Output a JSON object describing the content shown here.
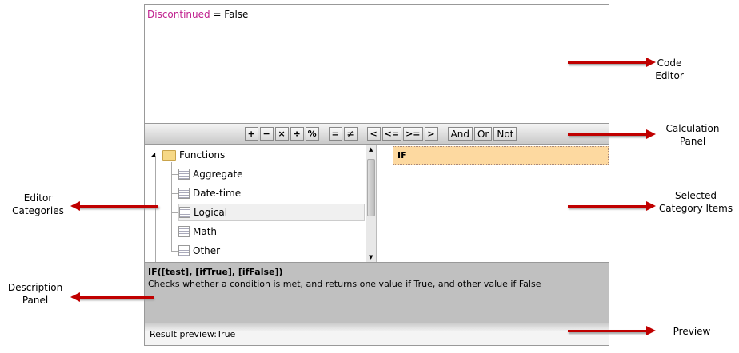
{
  "code": {
    "field": "Discontinued",
    "rest": " = False"
  },
  "toolbar": {
    "ops": [
      "+",
      "−",
      "×",
      "÷",
      "%"
    ],
    "compare": [
      "=",
      "≠"
    ],
    "relational": [
      "<",
      "<=",
      ">=",
      ">"
    ],
    "logic": [
      "And",
      "Or",
      "Not"
    ]
  },
  "tree": {
    "root": "Functions",
    "items": [
      "Aggregate",
      "Date-time",
      "Logical",
      "Math",
      "Other"
    ],
    "selected": "Logical"
  },
  "items": {
    "selected": "IF"
  },
  "description": {
    "signature": "IF([test], [ifTrue], [ifFalse])",
    "text": "Checks whether a condition is met, and returns one value if True, and other value if False"
  },
  "preview": {
    "label": "Result preview:",
    "value": "True"
  },
  "annotations": {
    "code_editor": "Code Editor",
    "calculation_panel": "Calculation Panel",
    "selected_items": "Selected Category Items",
    "preview": "Preview",
    "editor_categories": "Editor Categories",
    "description_panel": "Description Panel"
  }
}
